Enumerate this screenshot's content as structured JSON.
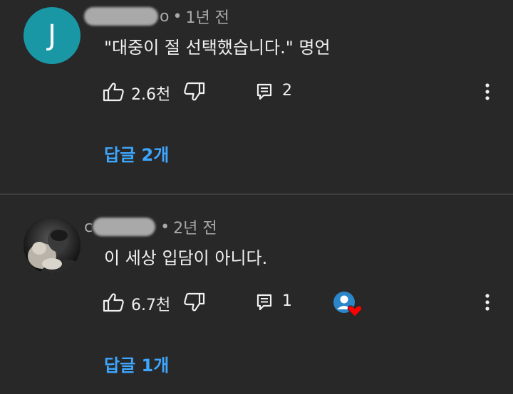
{
  "comments": [
    {
      "avatar_initial": "J",
      "avatar_color": "#1a97a5",
      "author_visible_suffix": "o",
      "separator": "•",
      "time": "1년 전",
      "text": "\"대중이 절 선택했습니다.\" 명언",
      "likes": "2.6천",
      "reply_count": "2",
      "replies_link": "답글 2개"
    },
    {
      "avatar_icon": "profile-photo",
      "author_visible_prefix": "c",
      "separator": "•",
      "time": "2년 전",
      "text": "이 세상 입담이 아니다.",
      "likes": "6.7천",
      "reply_count": "1",
      "creator_heart": "creator-heart-icon",
      "replies_link": "답글 1개"
    }
  ],
  "colors": {
    "background": "#282828",
    "text": "#f1f1f1",
    "meta": "#aaaaaa",
    "link": "#3ea6ff",
    "heart": "#ff0000"
  }
}
